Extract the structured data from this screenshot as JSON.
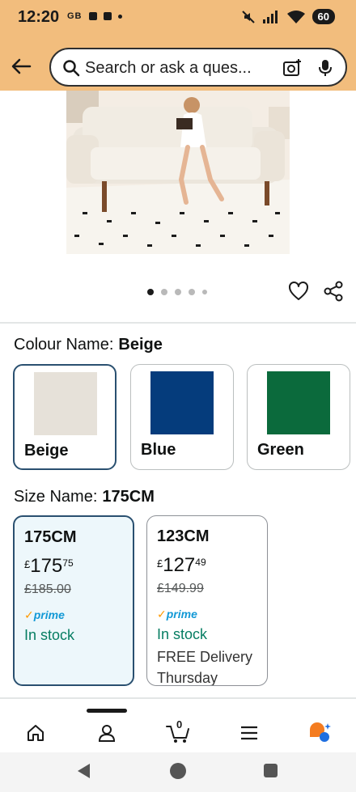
{
  "status_bar": {
    "time": "12:20",
    "notifications": [
      "GB",
      "app",
      "app",
      "dot"
    ],
    "battery": "60",
    "icons": [
      "mute-icon",
      "signal-icon",
      "wifi-icon"
    ]
  },
  "header": {
    "search_placeholder": "Search or ask a ques...",
    "icons": [
      "back-arrow-icon",
      "search-icon",
      "camera-search-icon",
      "microphone-icon"
    ]
  },
  "gallery": {
    "dots_total": 5,
    "active_index": 0
  },
  "colour": {
    "label": "Colour Name:",
    "selected": "Beige",
    "options": [
      {
        "name": "Beige",
        "color": "#e6e1d9"
      },
      {
        "name": "Blue",
        "color": "#053c7c"
      },
      {
        "name": "Green",
        "color": "#0b6a3c"
      }
    ]
  },
  "size": {
    "label": "Size Name:",
    "selected": "175CM",
    "options": [
      {
        "name": "175CM",
        "currency": "£",
        "price_whole": "175",
        "price_fraction": "75",
        "was_price": "£185.00",
        "prime": "prime",
        "stock": "In stock",
        "delivery": ""
      },
      {
        "name": "123CM",
        "currency": "£",
        "price_whole": "127",
        "price_fraction": "49",
        "was_price": "£149.99",
        "prime": "prime",
        "stock": "In stock",
        "delivery": "FREE Delivery Thursday"
      }
    ]
  },
  "bottom_nav": {
    "cart_count": "0",
    "items": [
      "home-icon",
      "account-icon",
      "cart-icon",
      "menu-icon",
      "rufus-icon"
    ],
    "active_index": 1
  },
  "colors": {
    "header_bg": "#f2bd7d",
    "selected_border": "#2a5070",
    "in_stock": "#067d62",
    "prime_blue": "#1399d6"
  }
}
